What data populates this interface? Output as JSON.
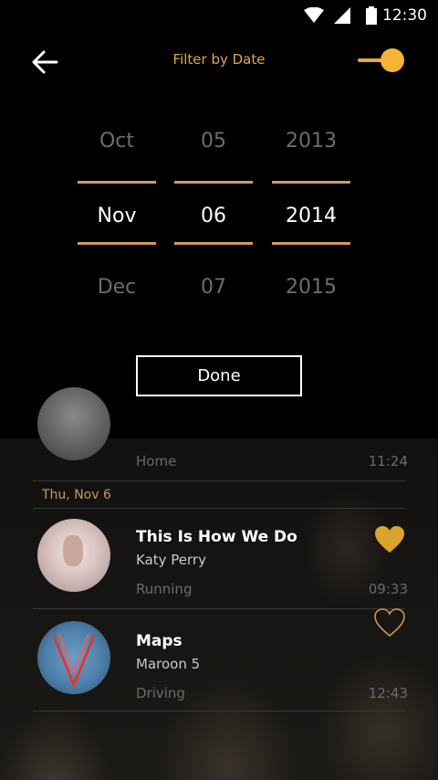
{
  "status_bar": {
    "time": "12:30"
  },
  "header": {
    "title": "Filter by Date"
  },
  "date_picker": {
    "month": {
      "prev": "Oct",
      "selected": "Nov",
      "next": "Dec"
    },
    "day": {
      "prev": "05",
      "selected": "06",
      "next": "07"
    },
    "year": {
      "prev": "2013",
      "selected": "2014",
      "next": "2015"
    },
    "done_label": "Done"
  },
  "list": {
    "partial_item": {
      "activity": "Home",
      "time": "11:24"
    },
    "date_header": "Thu, Nov 6",
    "items": [
      {
        "title": "This Is How We Do",
        "artist": "Katy Perry",
        "activity": "Running",
        "time": "09:33",
        "liked": true
      },
      {
        "title": "Maps",
        "artist": "Maroon 5",
        "activity": "Driving",
        "time": "12:43",
        "liked": false
      }
    ]
  },
  "colors": {
    "accent": "#f5b534",
    "picker_line": "#d29a5d",
    "title": "#e0a64a"
  }
}
